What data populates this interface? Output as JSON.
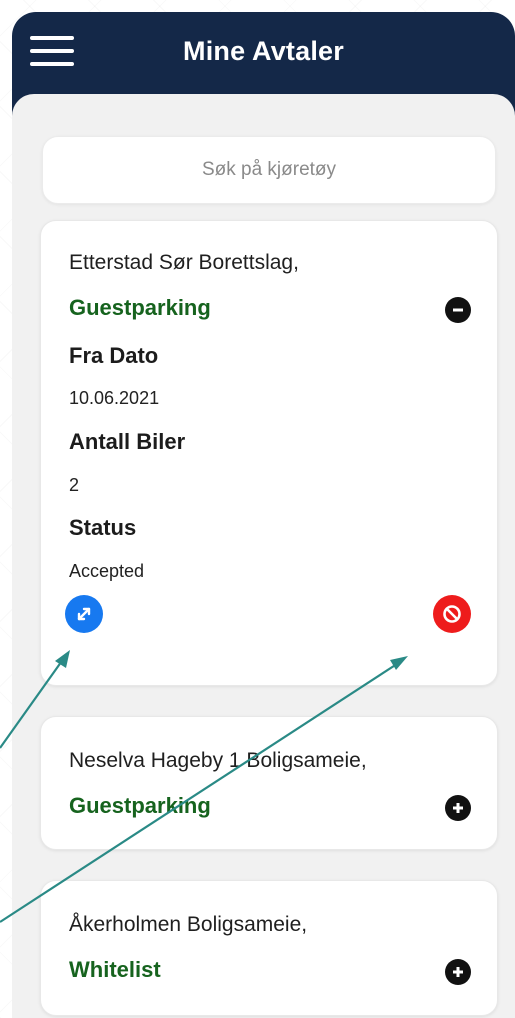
{
  "header": {
    "title": "Mine Avtaler"
  },
  "search": {
    "placeholder": "Søk på kjøretøy"
  },
  "agreements": [
    {
      "location": "Etterstad Sør Borettslag,",
      "type": "Guestparking",
      "expanded": true,
      "details": [
        {
          "label": "Fra Dato",
          "value": "10.06.2021"
        },
        {
          "label": "Antall Biler",
          "value": "2"
        },
        {
          "label": "Status",
          "value": "Accepted"
        }
      ]
    },
    {
      "location": "Neselva Hageby 1 Boligsameie,",
      "type": "Guestparking",
      "expanded": false
    },
    {
      "location": "Åkerholmen Boligsameie,",
      "type": "Whitelist",
      "expanded": false
    }
  ],
  "colors": {
    "header_bg": "#142848",
    "type_text": "#16631e",
    "expand_button": "#1779f0",
    "block_button": "#ee1c1c",
    "annotation_arrow": "#2a8a86"
  },
  "icons": {
    "menu": "hamburger-menu-icon",
    "collapse": "minus-circle-icon",
    "expand": "plus-circle-icon",
    "open": "expand-arrows-icon",
    "cancel": "block-icon"
  }
}
